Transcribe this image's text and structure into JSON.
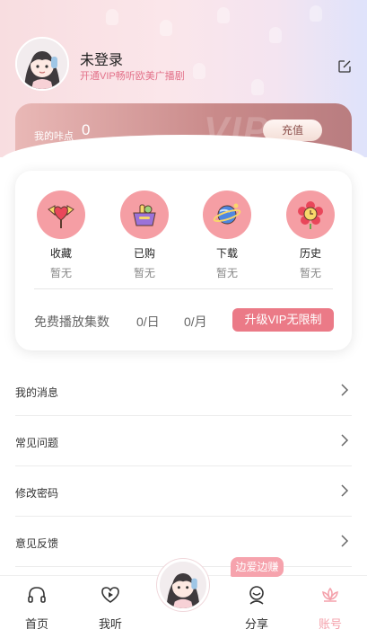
{
  "profile": {
    "name": "未登录",
    "vip_subtitle": "开通VIP畅听欧美广播剧"
  },
  "points": {
    "label": "我的咔点",
    "value": "0",
    "recharge_label": "充值",
    "watermark": "VIP"
  },
  "stats": [
    {
      "label": "收藏",
      "sub": "暂无",
      "icon": "lollipop-icon"
    },
    {
      "label": "已购",
      "sub": "暂无",
      "icon": "shopping-basket-icon"
    },
    {
      "label": "下载",
      "sub": "暂无",
      "icon": "planet-icon"
    },
    {
      "label": "历史",
      "sub": "暂无",
      "icon": "flower-clock-icon"
    }
  ],
  "free_plays": {
    "label": "免费播放集数",
    "per_day": "0/日",
    "per_month": "0/月",
    "upgrade_label": "升级VIP无限制"
  },
  "menu": [
    {
      "label": "我的消息"
    },
    {
      "label": "常见问题"
    },
    {
      "label": "修改密码"
    },
    {
      "label": "意见反馈"
    }
  ],
  "tabbar": {
    "items": [
      {
        "label": "首页",
        "icon": "headphones-icon"
      },
      {
        "label": "我听",
        "icon": "heart-play-icon"
      },
      {
        "label": "分享",
        "icon": "share-character-icon"
      },
      {
        "label": "账号",
        "icon": "lotus-icon"
      }
    ],
    "active": "账号",
    "earn_badge": "边爱边赚"
  },
  "colors": {
    "accent": "#eb7a87",
    "icon_circle": "#f59ea4",
    "points_card": "#c98a8a",
    "tab_active": "#f4a1ab"
  }
}
